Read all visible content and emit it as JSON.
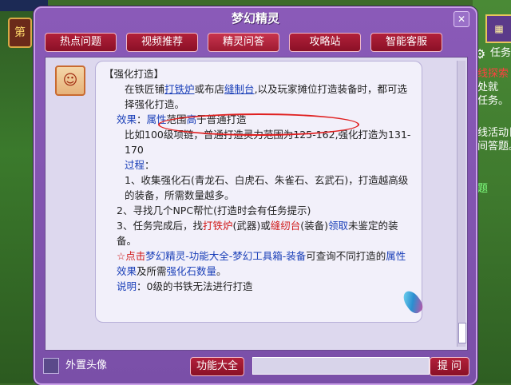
{
  "window": {
    "title": "梦幻精灵",
    "close_glyph": "✕"
  },
  "tabs": [
    {
      "label": "热点问题"
    },
    {
      "label": "视频推荐"
    },
    {
      "label": "精灵问答"
    },
    {
      "label": "攻略站"
    },
    {
      "label": "智能客服"
    }
  ],
  "background": {
    "side_badge": "第",
    "right_texts": [
      "任务",
      "线探索",
      "处就",
      "任务。",
      "线活动日",
      "间答题。",
      "题"
    ]
  },
  "answer": {
    "heading": "【强化打造】",
    "p1_a": "在铁匠铺",
    "p1_link1": "打铁炉",
    "p1_b": "或布店",
    "p1_link2": "缝制台",
    "p1_c": ",以及玩家摊位打造装备时，都可选择强化打造。",
    "effect_label": "效果",
    "effect_colon": "：",
    "effect_attr": "属性",
    "effect_mid": "范围",
    "effect_high": "高",
    "effect_end": "于普通打造",
    "example": "比如100级项链，普通打造灵力范围为125-162,强化打造为131-170",
    "process_label": "过程",
    "process_colon": "：",
    "step1": "1、收集强化石(青龙石、白虎石、朱雀石、玄武石)，打造越高级的装备，所需数量越多。",
    "step2": "2、寻找几个NPC帮忙(打造时会有任务提示)",
    "step3_a": "3、任务完成后，找",
    "step3_b": "打铁炉",
    "step3_c": "(武器)或",
    "step3_d": "缝纫台",
    "step3_e": "(装备)",
    "step3_f": "领取",
    "step3_g": "未鉴定的装备。",
    "tip_star": "☆",
    "tip_a": "点击",
    "tip_b": "梦幻精灵-功能大全-梦幻工具箱-装备",
    "tip_c": "可查询不同打造的",
    "tip_d": "属性效果",
    "tip_e": "及所需",
    "tip_f": "强化石数量",
    "tip_g": "。",
    "note_label": "说明",
    "note_colon": "：",
    "note_text": "0级的书铁无法进行打造"
  },
  "bottom": {
    "checkbox_label": "外置头像",
    "features_button": "功能大全",
    "ask_input_value": "",
    "ask_button": "提 问"
  },
  "colors": {
    "accent_red": "#d01818",
    "link_blue": "#1a3fb8",
    "window_purple": "#7a4fa8"
  }
}
